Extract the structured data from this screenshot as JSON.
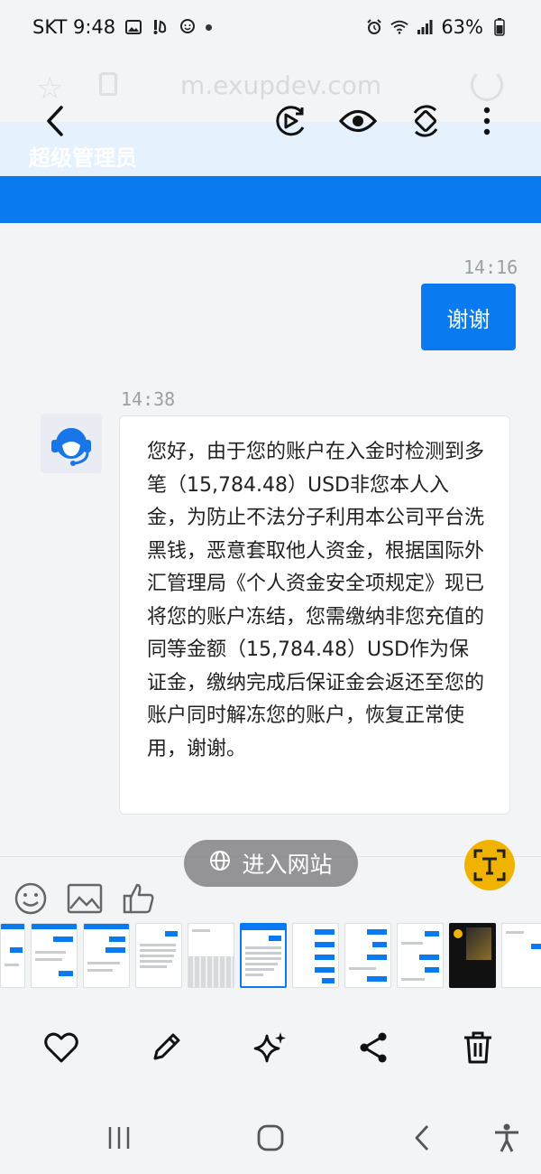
{
  "status": {
    "carrier_time": "SKT 9:48",
    "battery": "63%"
  },
  "browser": {
    "url": "m.exupdev.com"
  },
  "page": {
    "header_title": "超级管理员"
  },
  "messages": [
    {
      "time": "14:16",
      "direction": "outgoing",
      "text": "谢谢"
    },
    {
      "time": "14:38",
      "direction": "incoming",
      "text": "您好，由于您的账户在入金时检测到多笔（15,784.48）USD非您本人入金，为防止不法分子利用本公司平台洗黑钱，恶意套取他人资金，根据国际外汇管理局《个人资金安全项规定》现已将您的账户冻结，您需缴纳非您充值的同等金额（15,784.48）USD作为保证金，缴纳完成后保证金会返还至您的账户同时解冻您的账户，恢复正常使用，谢谢。"
    }
  ],
  "overlay": {
    "visit_site_label": "进入网站"
  },
  "colors": {
    "accent_blue": "#0a7af0",
    "text_recognition": "#f0b400",
    "bubble_border": "#e3e5e8"
  },
  "icons": {
    "toolbar": [
      "back-icon",
      "video-play-icon",
      "eye-icon",
      "rotate-icon",
      "more-icon"
    ],
    "input": [
      "emoji-icon",
      "image-icon",
      "thumbs-up-icon"
    ],
    "actions": [
      "heart-icon",
      "pencil-icon",
      "sparkle-icon",
      "share-icon",
      "trash-icon"
    ],
    "nav": [
      "recent-apps-icon",
      "home-icon",
      "back-nav-icon",
      "accessibility-icon"
    ]
  }
}
